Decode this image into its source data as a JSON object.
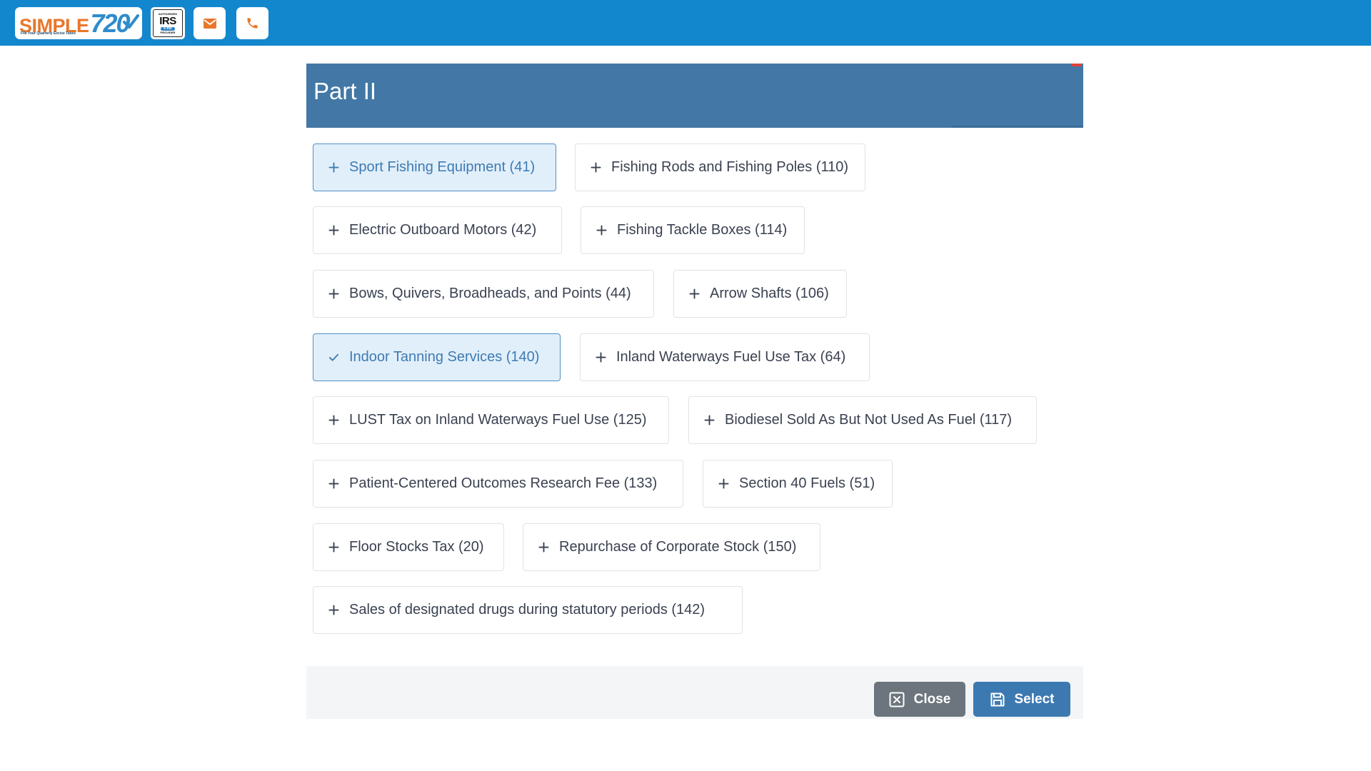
{
  "header": {
    "logo": {
      "brand_simple": "SIMPLE",
      "brand_number": "720",
      "tagline": "File Your Quarterly Excise Taxes",
      "check_icon": "check-circle-icon"
    },
    "irs_badge": {
      "authorized": "AUTHORIZED",
      "irs": "IRS",
      "efile": "e-file",
      "provider": "PROVIDER"
    },
    "icons": [
      "envelope-icon",
      "phone-icon"
    ],
    "colors": {
      "bar": "#1387cd",
      "icon": "#e8772b"
    }
  },
  "modal": {
    "title": "Part II",
    "options": [
      {
        "label": "Sport Fishing Equipment (41)",
        "selected": true,
        "icon": "plus-icon"
      },
      {
        "label": "Fishing Rods and Fishing Poles (110)",
        "selected": false,
        "icon": "plus-icon"
      },
      {
        "label": "Electric Outboard Motors (42)",
        "selected": false,
        "icon": "plus-icon"
      },
      {
        "label": "Fishing Tackle Boxes (114)",
        "selected": false,
        "icon": "plus-icon"
      },
      {
        "label": "Bows, Quivers, Broadheads, and Points (44)",
        "selected": false,
        "icon": "plus-icon"
      },
      {
        "label": "Arrow Shafts (106)",
        "selected": false,
        "icon": "plus-icon"
      },
      {
        "label": "Indoor Tanning Services (140)",
        "selected": true,
        "icon": "check-icon"
      },
      {
        "label": "Inland Waterways Fuel Use Tax (64)",
        "selected": false,
        "icon": "plus-icon"
      },
      {
        "label": "LUST Tax on Inland Waterways Fuel Use (125)",
        "selected": false,
        "icon": "plus-icon"
      },
      {
        "label": "Biodiesel Sold As But Not Used As Fuel (117)",
        "selected": false,
        "icon": "plus-icon"
      },
      {
        "label": "Patient-Centered Outcomes Research Fee (133)",
        "selected": false,
        "icon": "plus-icon"
      },
      {
        "label": "Section 40 Fuels (51)",
        "selected": false,
        "icon": "plus-icon"
      },
      {
        "label": "Floor Stocks Tax (20)",
        "selected": false,
        "icon": "plus-icon"
      },
      {
        "label": "Repurchase of Corporate Stock (150)",
        "selected": false,
        "icon": "plus-icon"
      },
      {
        "label": "Sales of designated drugs during statutory periods (142)",
        "selected": false,
        "icon": "plus-icon"
      }
    ],
    "footer": {
      "close_label": "Close",
      "select_label": "Select"
    },
    "colors": {
      "header": "#4378a6",
      "selected_bg": "#e1effa",
      "selected_border": "#4f8fc7",
      "close_button": "#6c757d",
      "select_button": "#3d79b1"
    }
  }
}
